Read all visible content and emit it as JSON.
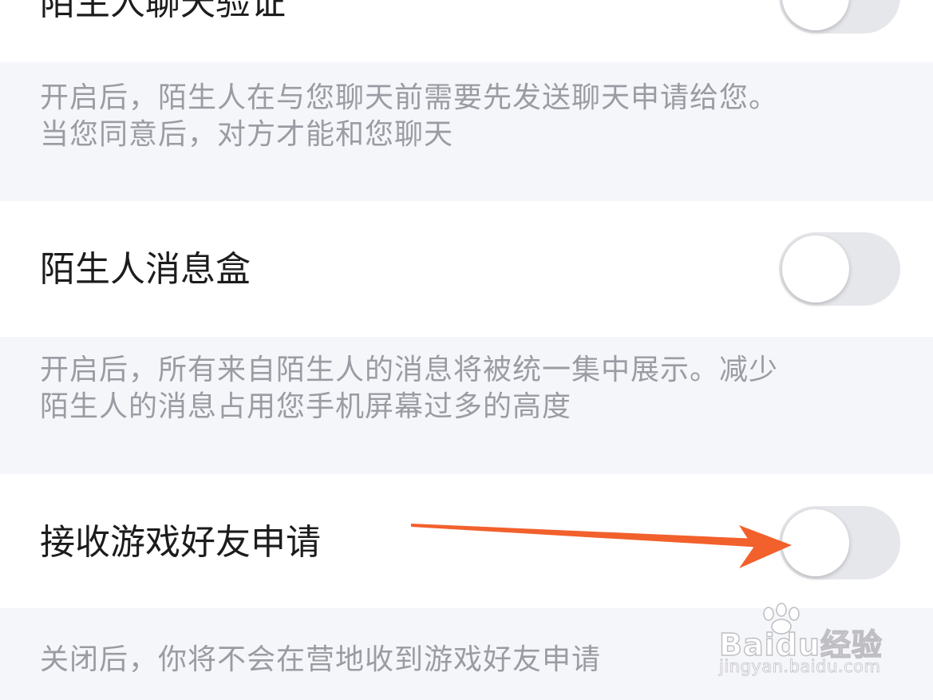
{
  "settings": [
    {
      "label": "陌生人聊天验证",
      "enabled": false,
      "description": [
        "开启后，陌生人在与您聊天前需要先发送聊天申请给您。",
        "当您同意后，对方才能和您聊天"
      ]
    },
    {
      "label": "陌生人消息盒",
      "enabled": false,
      "description": [
        "开启后，所有来自陌生人的消息将被统一集中展示。减少",
        "陌生人的消息占用您手机屏幕过多的高度"
      ]
    },
    {
      "label": "接收游戏好友申请",
      "enabled": false,
      "description": [
        "关闭后，你将不会在营地收到游戏好友申请"
      ]
    }
  ],
  "annotation": {
    "arrow_color": "#f2602c",
    "points_to": "接收游戏好友申请 toggle"
  },
  "watermark": {
    "logo": "Baidu经验",
    "url": "jingyan.baidu.com"
  }
}
